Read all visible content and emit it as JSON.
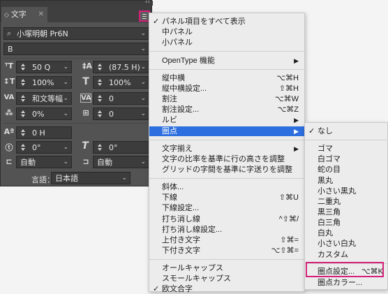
{
  "panel": {
    "tab_title": "文字",
    "font_family": "小塚明朝 Pr6N",
    "font_style": "B",
    "font_size": "50 Q",
    "leading": "(87.5 H)",
    "vertical_scale": "100%",
    "horizontal_scale": "100%",
    "tracking_mode": "和文等幅",
    "tracking": "0",
    "tsume": "0%",
    "aki": "0",
    "baseline_shift": "0 H",
    "rotation": "0°",
    "skew": "0°",
    "aki_before": "自動",
    "aki_after": "自動",
    "language_label": "言語：",
    "language": "日本語"
  },
  "menu": {
    "items": [
      {
        "label": "パネル項目をすべて表示",
        "checked": true
      },
      {
        "label": "中パネル"
      },
      {
        "label": "小パネル"
      },
      {
        "label": "OpenType 機能",
        "submenu": true
      },
      {
        "label": "縦中横",
        "shortcut": "⌥⌘H"
      },
      {
        "label": "縦中横設定...",
        "shortcut": "⇧⌘H"
      },
      {
        "label": "割注",
        "shortcut": "⌥⌘W"
      },
      {
        "label": "割注設定...",
        "shortcut": "⌥⌘Z"
      },
      {
        "label": "ルビ",
        "submenu": true
      },
      {
        "label": "圏点",
        "submenu": true,
        "highlighted": true
      },
      {
        "label": "文字揃え",
        "submenu": true
      },
      {
        "label": "文字の比率を基準に行の高さを調整"
      },
      {
        "label": "グリッドの字間を基準に字送りを調整"
      },
      {
        "label": "斜体..."
      },
      {
        "label": "下線",
        "shortcut": "⇧⌘U"
      },
      {
        "label": "下線設定..."
      },
      {
        "label": "打ち消し線",
        "shortcut": "^⇧⌘/"
      },
      {
        "label": "打ち消し線設定..."
      },
      {
        "label": "上付き文字",
        "shortcut": "⇧⌘="
      },
      {
        "label": "下付き文字",
        "shortcut": "⌥⇧⌘="
      },
      {
        "label": "オールキャップス"
      },
      {
        "label": "スモールキャップス"
      },
      {
        "label": "欧文合字",
        "checked": true
      }
    ]
  },
  "submenu": {
    "items": [
      {
        "label": "なし",
        "checked": true
      },
      {
        "label": "ゴマ"
      },
      {
        "label": "白ゴマ"
      },
      {
        "label": "蛇の目"
      },
      {
        "label": "黒丸"
      },
      {
        "label": "小さい黒丸"
      },
      {
        "label": "二重丸"
      },
      {
        "label": "黒三角"
      },
      {
        "label": "白三角"
      },
      {
        "label": "白丸"
      },
      {
        "label": "小さい白丸"
      },
      {
        "label": "カスタム"
      },
      {
        "label": "圏点設定...",
        "shortcut": "⌥⌘K"
      },
      {
        "label": "圏点カラー..."
      }
    ]
  },
  "colors": {
    "highlight": "#2d6fdf",
    "annotation": "#d6217a",
    "panel": "#535353"
  }
}
